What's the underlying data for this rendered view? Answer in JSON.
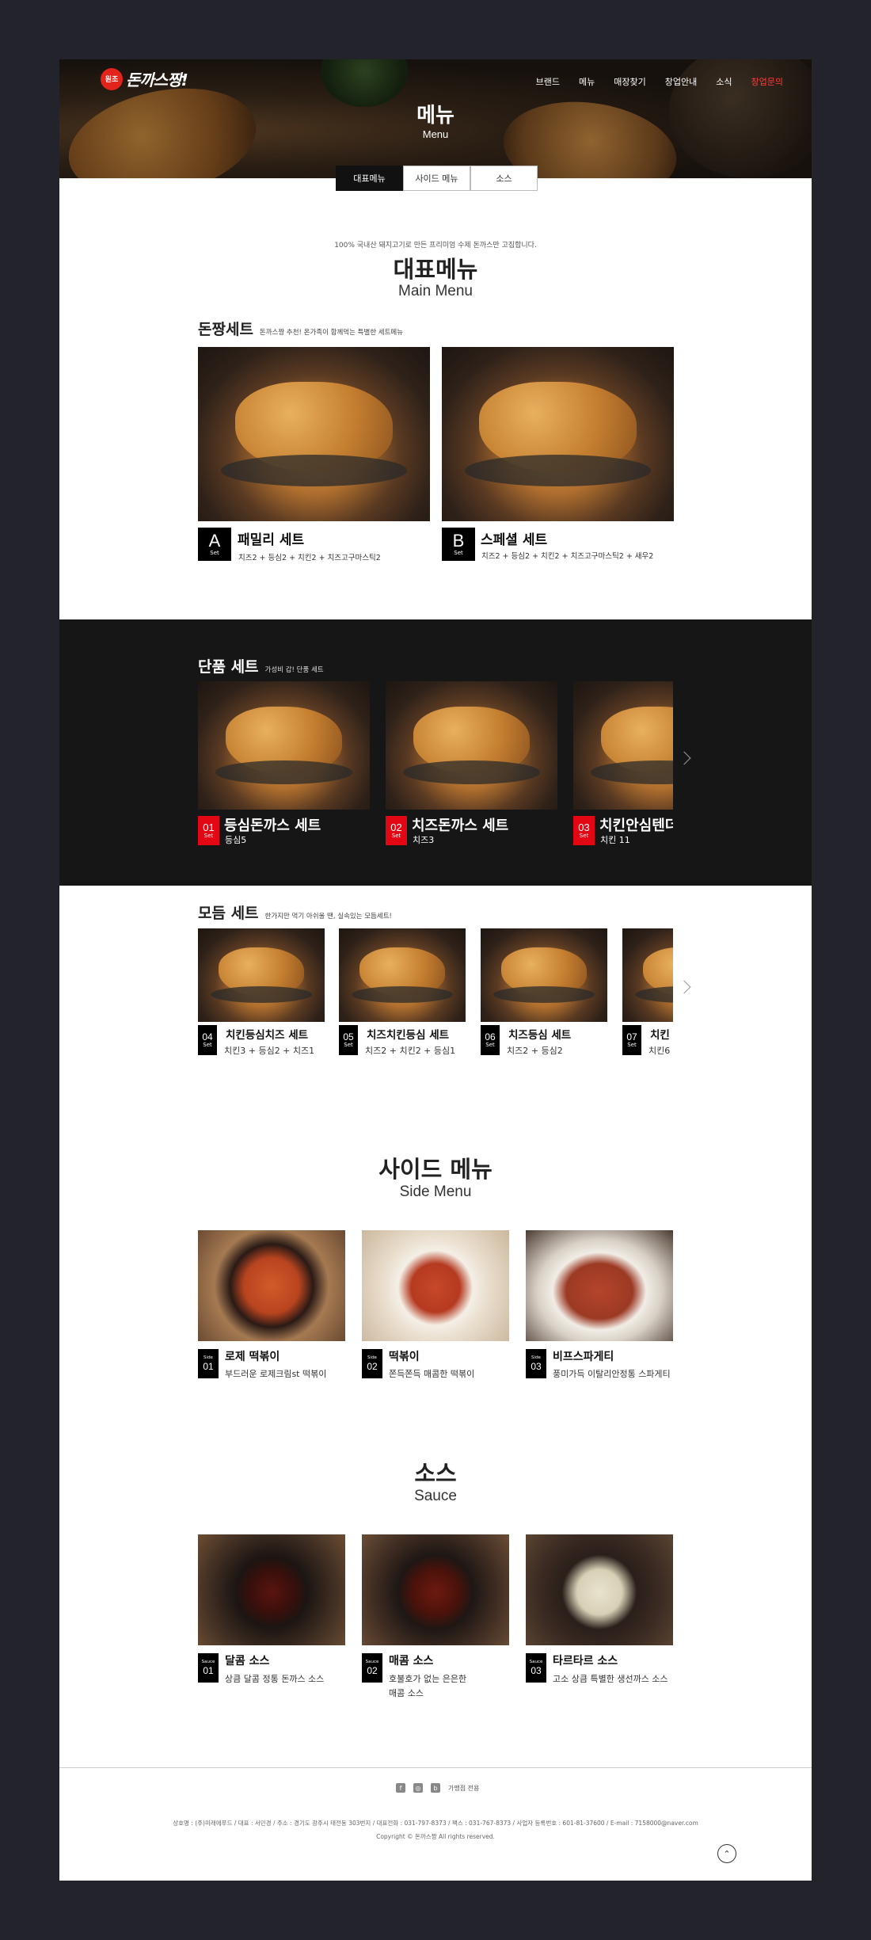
{
  "header": {
    "logo_seal": "원조",
    "logo_text": "돈까스짱!",
    "nav": [
      "브랜드",
      "메뉴",
      "매장찾기",
      "창업안내",
      "소식",
      "창업문의"
    ],
    "title": "메뉴",
    "subtitle": "Menu"
  },
  "tabs": [
    "대표메뉴",
    "사이드 메뉴",
    "소스"
  ],
  "main_menu": {
    "intro": "100% 국내산 돼지고기로 만든 프리미엄 수제 돈까스만 고집합니다.",
    "title_ko": "대표메뉴",
    "title_en": "Main Menu",
    "group": {
      "title": "돈짱세트",
      "desc": "돈까스짱 추천! 온가족이 함께먹는 특별한 세트메뉴"
    },
    "items": [
      {
        "badge": "A",
        "badge_sub": "Set",
        "name": "패밀리 세트",
        "desc": "치즈2 + 등심2 + 치킨2 + 치즈고구마스틱2"
      },
      {
        "badge": "B",
        "badge_sub": "Set",
        "name": "스페셜 세트",
        "desc": "치즈2 + 등심2 + 치킨2 + 치즈고구마스틱2 + 새우2"
      }
    ]
  },
  "single_set": {
    "title": "단품 세트",
    "desc": "가성비 갑! 단품 세트",
    "items": [
      {
        "badge": "01",
        "badge_sub": "Set",
        "name": "등심돈까스 세트",
        "desc": "등심5"
      },
      {
        "badge": "02",
        "badge_sub": "Set",
        "name": "치즈돈까스 세트",
        "desc": "치즈3"
      },
      {
        "badge": "03",
        "badge_sub": "Set",
        "name": "치킨안심텐더",
        "desc": "치킨 11"
      }
    ]
  },
  "combo_set": {
    "title": "모듬 세트",
    "desc": "한가지만 먹기 아쉬울 땐, 실속있는 모듬세트!",
    "items": [
      {
        "badge": "04",
        "badge_sub": "Set",
        "name": "치킨등심치즈 세트",
        "desc": "치킨3 + 등심2 + 치즈1"
      },
      {
        "badge": "05",
        "badge_sub": "Set",
        "name": "치즈치킨등심 세트",
        "desc": "치즈2 + 치킨2 + 등심1"
      },
      {
        "badge": "06",
        "badge_sub": "Set",
        "name": "치즈등심 세트",
        "desc": "치즈2 + 등심2"
      },
      {
        "badge": "07",
        "badge_sub": "Set",
        "name": "치킨",
        "desc": "치킨6"
      }
    ]
  },
  "side_menu": {
    "title_ko": "사이드 메뉴",
    "title_en": "Side Menu",
    "items": [
      {
        "badge_top": "Side",
        "badge": "01",
        "name": "로제 떡볶이",
        "desc": "부드러운 로제크림st 떡볶이"
      },
      {
        "badge_top": "Side",
        "badge": "02",
        "name": "떡볶이",
        "desc": "쫀득쫀득 매콤한 떡볶이"
      },
      {
        "badge_top": "Side",
        "badge": "03",
        "name": "비프스파게티",
        "desc": "풍미가득 이탈리안정통 스파게티"
      }
    ]
  },
  "sauce": {
    "title_ko": "소스",
    "title_en": "Sauce",
    "items": [
      {
        "badge_top": "Sauce",
        "badge": "01",
        "name": "달콤 소스",
        "desc": "상큼 달콤 정통 돈까스 소스"
      },
      {
        "badge_top": "Sauce",
        "badge": "02",
        "name": "매콤 소스",
        "desc": "호불호가 없는 은은한",
        "desc2": "매콤 소스"
      },
      {
        "badge_top": "Sauce",
        "badge": "03",
        "name": "타르타르 소스",
        "desc": "고소 상큼 특별한 생선까스 소스"
      }
    ]
  },
  "footer": {
    "social_label": "가맹점 전용",
    "info": "상호명 : (주)미래에푸드 / 대표 : 서민경 / 주소 : 경기도 광주시 태전동 303번지 / 대표전화 : 031-797-8373 / 팩스 : 031-767-8373 / 사업자 등록번호 : 601-81-37600 / E-mail : 7158000@naver.com",
    "copyright": "Copyright © 돈까스짱 All rights reserved.",
    "top_button": "⌃"
  },
  "colors": {
    "accent": "#e30613",
    "dark_band": "#161616",
    "page_bg": "#23242b"
  }
}
